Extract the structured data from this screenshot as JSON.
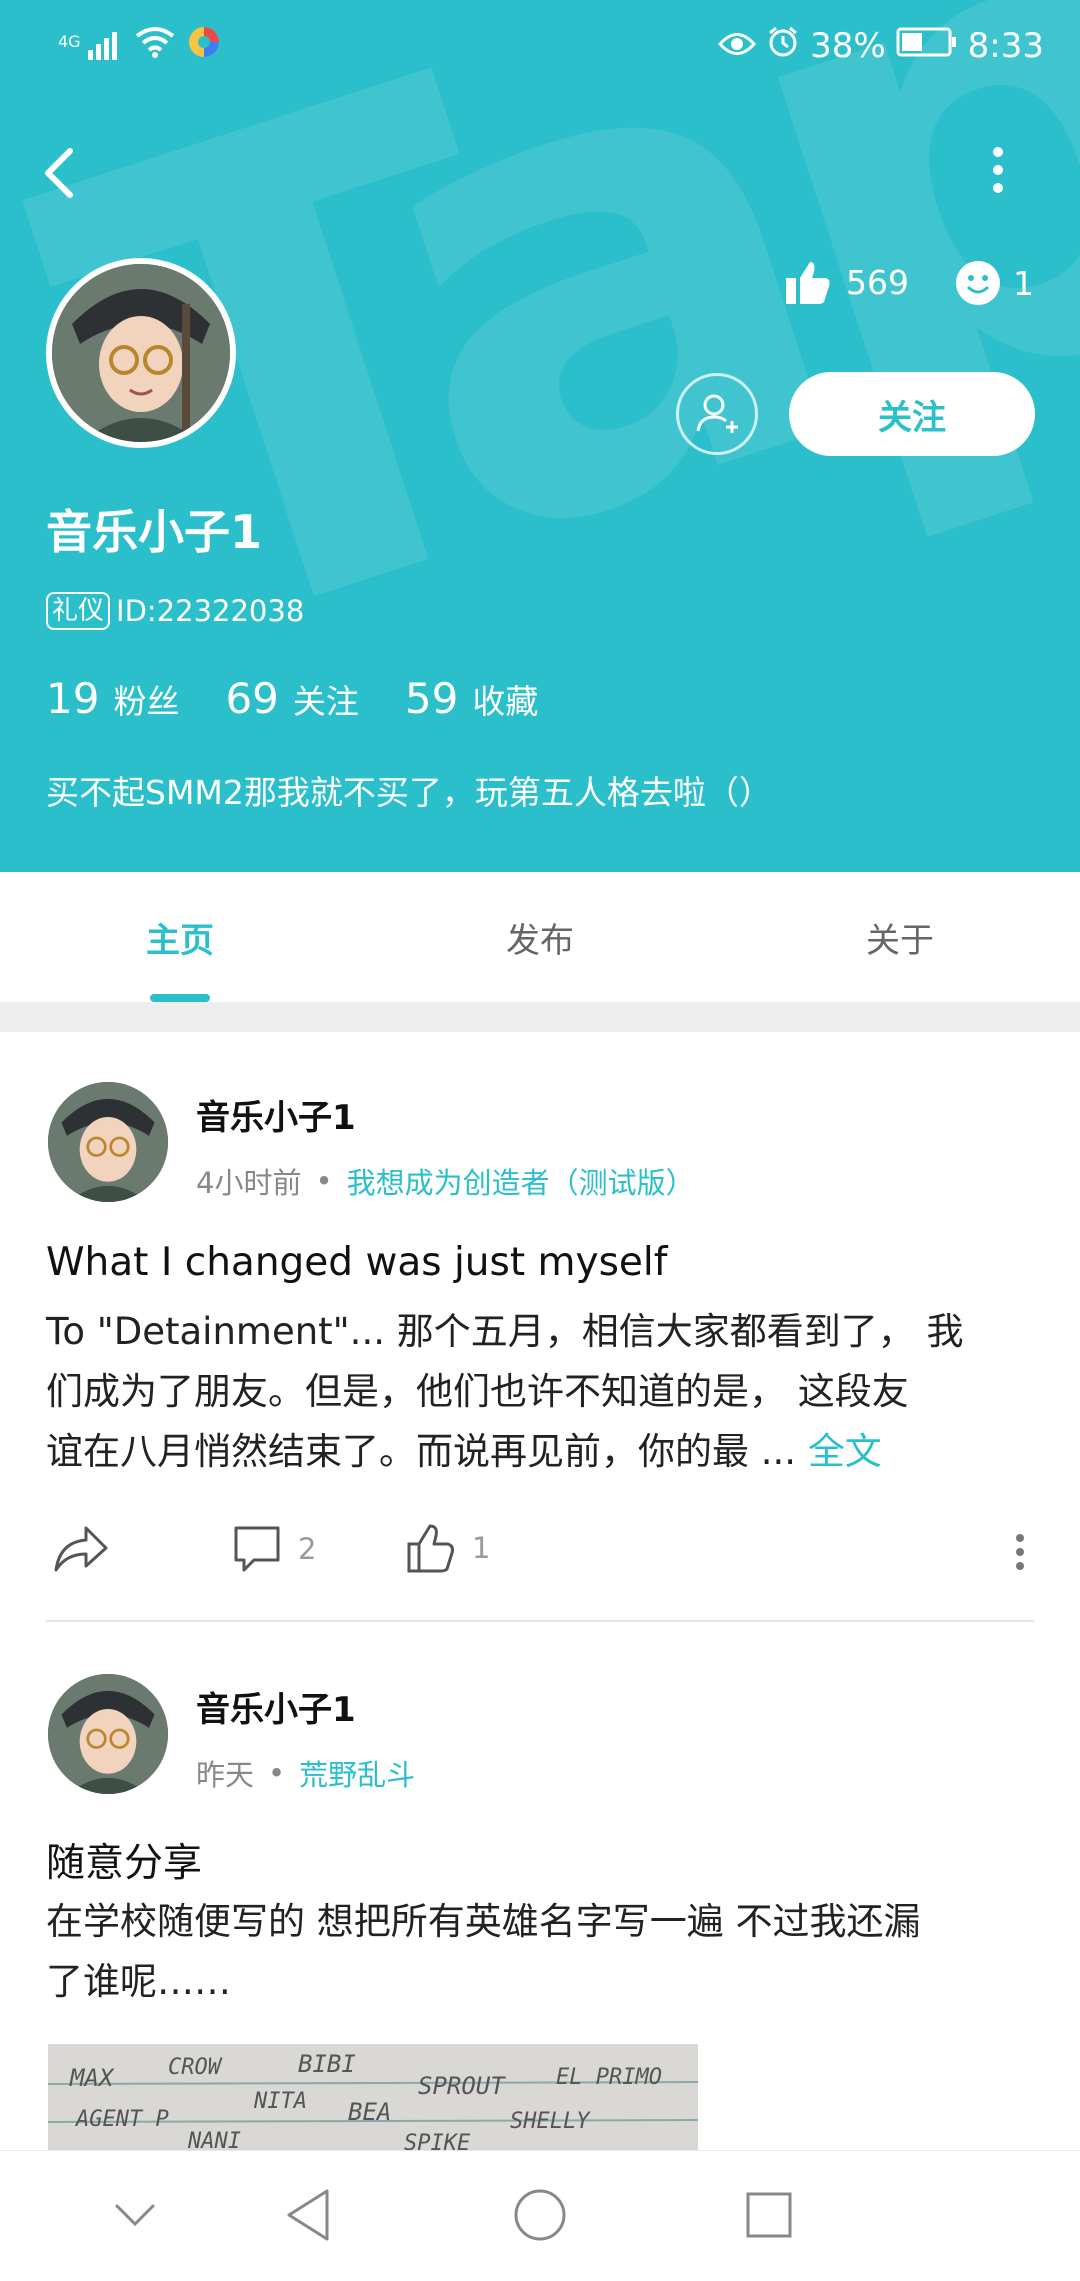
{
  "status_bar": {
    "signal": "4G",
    "battery": "38%",
    "time": "8:33"
  },
  "profile": {
    "watermark": "TapTap",
    "likes": "569",
    "smiles": "1",
    "follow_label": "关注",
    "name": "音乐小子1",
    "badge": "礼仪",
    "id_text": "ID:22322038",
    "stats": [
      {
        "num": "19",
        "label": "粉丝"
      },
      {
        "num": "69",
        "label": "关注"
      },
      {
        "num": "59",
        "label": "收藏"
      }
    ],
    "bio": "买不起SMM2那我就不买了，玩第五人格去啦（）"
  },
  "tabs": [
    "主页",
    "发布",
    "关于"
  ],
  "posts": [
    {
      "author": "音乐小子1",
      "time": "4小时前",
      "topic": "我想成为创造者（测试版）",
      "title": "What I changed was just myself",
      "body_lines": [
        "To \"Detainment\"... 那个五月，相信大家都看到了， 我",
        "们成为了朋友。但是，他们也许不知道的是， 这段友",
        "谊在八月悄然结束了。而说再见前，你的最 ..."
      ],
      "more": "全文",
      "comments": "2",
      "likes": "1"
    },
    {
      "author": "音乐小子1",
      "time": "昨天",
      "topic": "荒野乱斗",
      "title": "随意分享",
      "body_lines": [
        "在学校随便写的 想把所有英雄名字写一遍 不过我还漏",
        "了谁呢……"
      ],
      "image_words": [
        "MAX",
        "CROW",
        "BIBI",
        "SPROUT",
        "EL PRIMO",
        "AGENT P",
        "NITA",
        "BEA",
        "SHELLY",
        "NANI",
        "SPIKE"
      ]
    }
  ]
}
